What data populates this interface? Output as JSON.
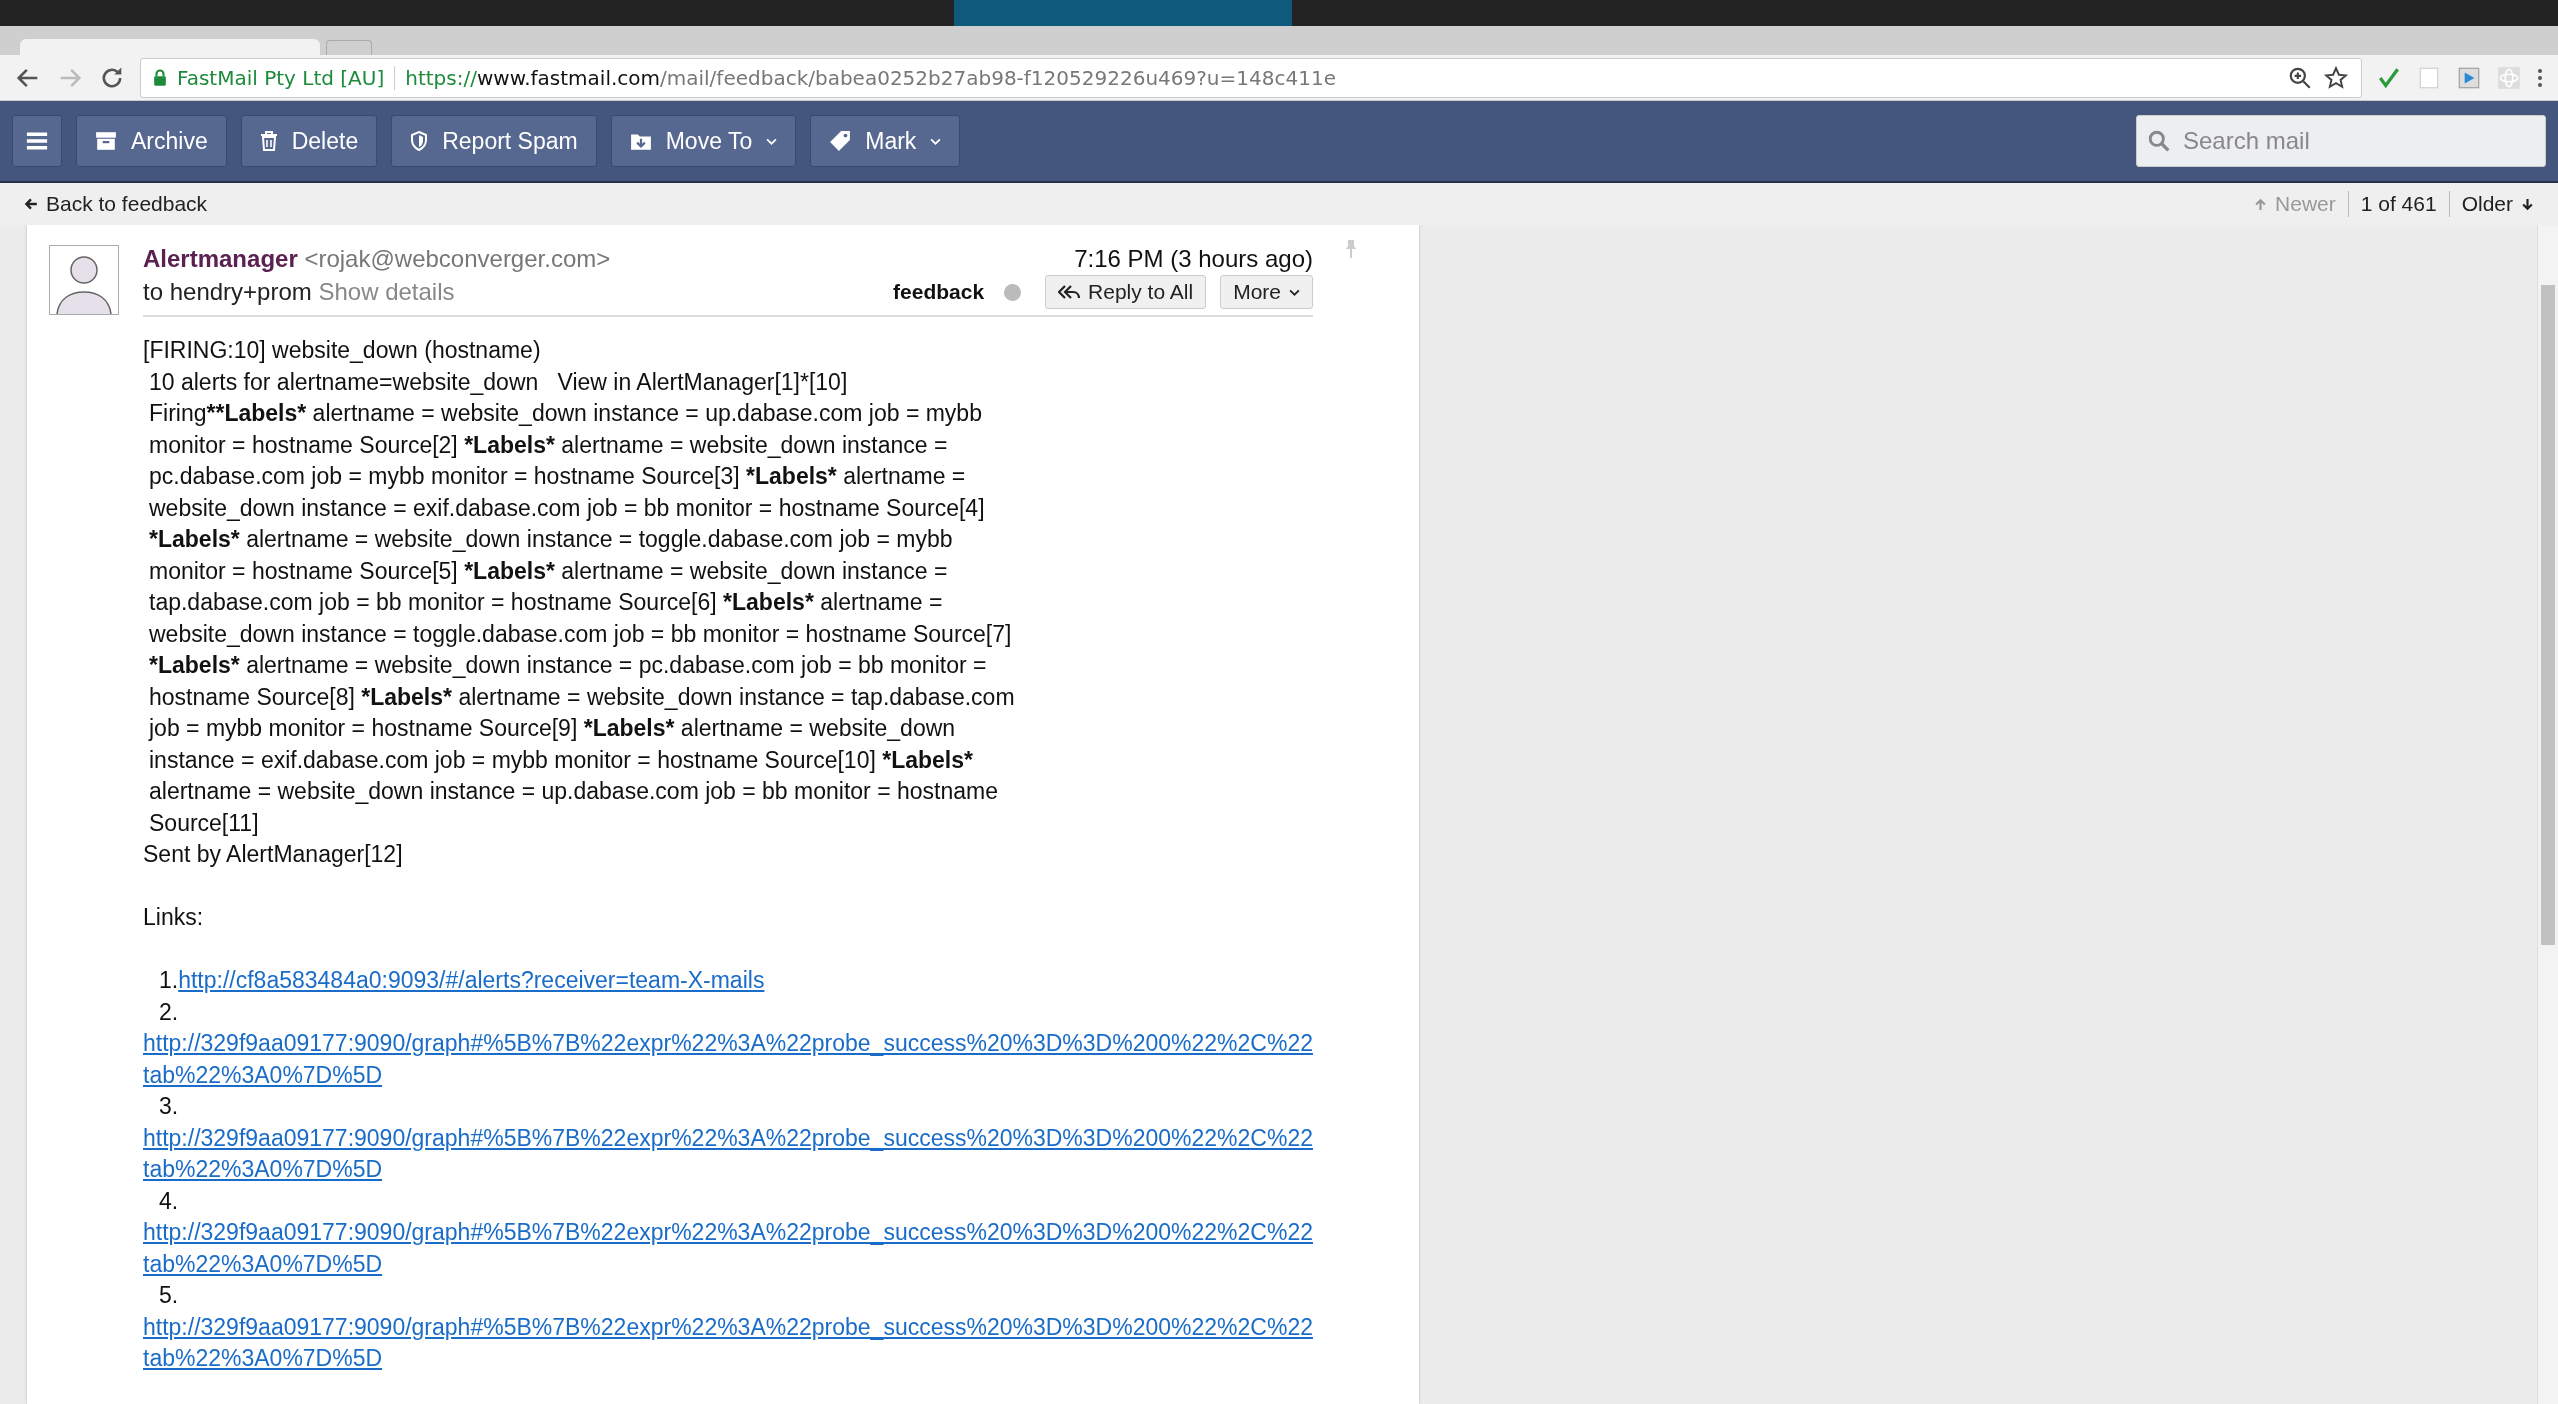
{
  "browser": {
    "secure_label": "FastMail Pty Ltd [AU]",
    "url_scheme": "https://",
    "url_host": "www.fastmail.com",
    "url_path": "/mail/feedback/babea0252b27ab98-f120529226u469?u=148c411e"
  },
  "toolbar": {
    "buttons": [
      {
        "label": "Archive",
        "kind": "archive",
        "dropdown": false
      },
      {
        "label": "Delete",
        "kind": "delete",
        "dropdown": false
      },
      {
        "label": "Report Spam",
        "kind": "spam",
        "dropdown": false
      },
      {
        "label": "Move To",
        "kind": "move",
        "dropdown": true
      },
      {
        "label": "Mark",
        "kind": "mark",
        "dropdown": true
      }
    ],
    "search": {
      "placeholder": "Search mail"
    }
  },
  "nav": {
    "back": "Back to feedback",
    "newer": "Newer",
    "newer_disabled": true,
    "position": "1 of 461",
    "older": "Older"
  },
  "message": {
    "sender_name": "Alertmanager",
    "sender_email": "<rojak@webconverger.com>",
    "recipient": "to hendry+prom",
    "show_details": "Show details",
    "time": "7:16 PM (3 hours ago)",
    "label": "feedback",
    "reply_all": "Reply to All",
    "more": "More",
    "subject_line": "[FIRING:10] website_down (hostname)",
    "summary": "10 alerts for alertname=website_down   View in AlertManager[1]*[10]",
    "details": [
      {
        "text": "Firing",
        "bold": false
      },
      {
        "text": "**Labels*",
        "bold": true
      },
      {
        "text": " alertname = website_down instance = up.dabase.com job = mybb monitor = hostname Source[2] ",
        "bold": false
      },
      {
        "text": "*Labels*",
        "bold": true
      },
      {
        "text": " alertname = website_down instance = pc.dabase.com job = mybb monitor = hostname Source[3] ",
        "bold": false
      },
      {
        "text": "*Labels*",
        "bold": true
      },
      {
        "text": " alertname = website_down instance = exif.dabase.com job = bb monitor = hostname Source[4] ",
        "bold": false
      },
      {
        "text": "*Labels*",
        "bold": true
      },
      {
        "text": " alertname = website_down instance = toggle.dabase.com job = mybb monitor = hostname Source[5] ",
        "bold": false
      },
      {
        "text": "*Labels*",
        "bold": true
      },
      {
        "text": " alertname = website_down instance = tap.dabase.com job = bb monitor = hostname Source[6] ",
        "bold": false
      },
      {
        "text": "*Labels*",
        "bold": true
      },
      {
        "text": " alertname = website_down instance = toggle.dabase.com job = bb monitor = hostname Source[7] ",
        "bold": false
      },
      {
        "text": "*Labels*",
        "bold": true
      },
      {
        "text": " alertname = website_down instance = pc.dabase.com job = bb monitor = hostname Source[8] ",
        "bold": false
      },
      {
        "text": "*Labels*",
        "bold": true
      },
      {
        "text": " alertname = website_down instance = tap.dabase.com job = mybb monitor = hostname Source[9] ",
        "bold": false
      },
      {
        "text": "*Labels*",
        "bold": true
      },
      {
        "text": " alertname = website_down instance = exif.dabase.com job = mybb monitor = hostname Source[10] ",
        "bold": false
      },
      {
        "text": "*Labels*",
        "bold": true
      },
      {
        "text": " alertname = website_down instance = up.dabase.com job = bb monitor = hostname Source[11]",
        "bold": false
      }
    ],
    "sent_by": "Sent by AlertManager[12]",
    "links_heading": "Links:",
    "links": [
      {
        "number": "1.",
        "url": "http://cf8a583484a0:9093/#/alerts?receiver=team-X-mails",
        "inline": true
      },
      {
        "number": "2.",
        "url": "http://329f9aa09177:9090/graph#%5B%7B%22expr%22%3A%22probe_success%20%3D%3D%200%22%2C%22tab%22%3A0%7D%5D",
        "inline": false
      },
      {
        "number": "3.",
        "url": "http://329f9aa09177:9090/graph#%5B%7B%22expr%22%3A%22probe_success%20%3D%3D%200%22%2C%22tab%22%3A0%7D%5D",
        "inline": false
      },
      {
        "number": "4.",
        "url": "http://329f9aa09177:9090/graph#%5B%7B%22expr%22%3A%22probe_success%20%3D%3D%200%22%2C%22tab%22%3A0%7D%5D",
        "inline": false
      },
      {
        "number": "5.",
        "url": "http://329f9aa09177:9090/graph#%5B%7B%22expr%22%3A%22probe_success%20%3D%3D%200%22%2C%22tab%22%3A0%7D%5D",
        "inline": false
      }
    ]
  }
}
